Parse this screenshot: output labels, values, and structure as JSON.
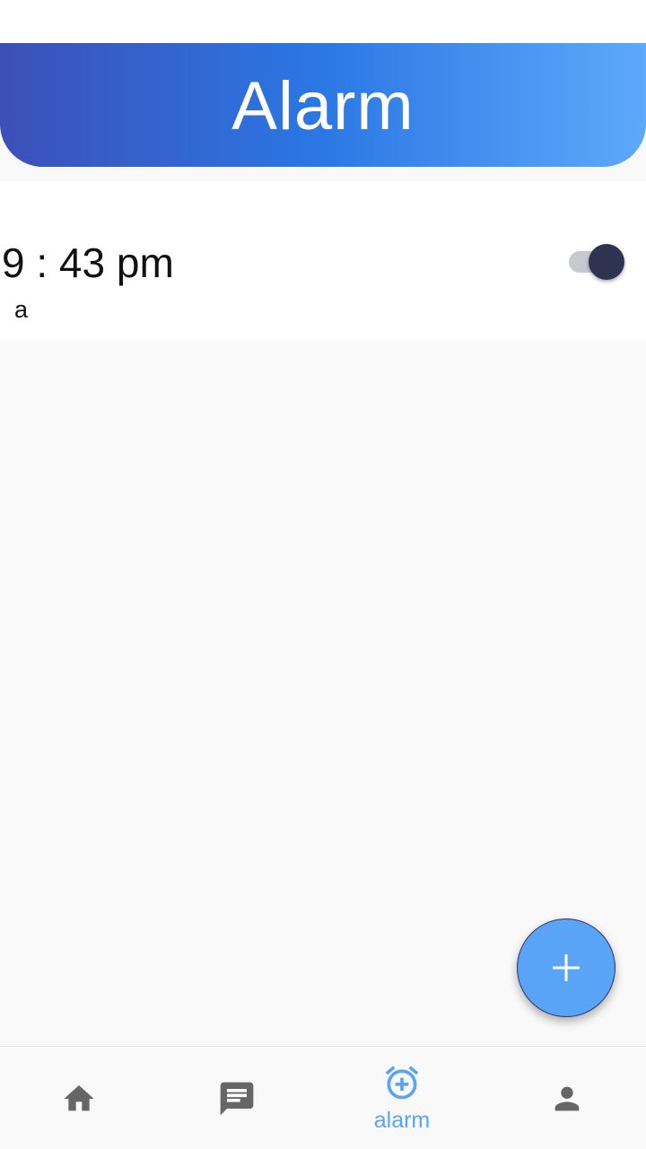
{
  "header": {
    "title": "Alarm"
  },
  "alarms": [
    {
      "time": "9 : 43 pm",
      "label": "a",
      "enabled": true
    }
  ],
  "fab": {
    "icon": "plus-icon"
  },
  "bottom_nav": {
    "items": [
      {
        "icon": "home-icon",
        "label": "",
        "active": false
      },
      {
        "icon": "chat-icon",
        "label": "",
        "active": false
      },
      {
        "icon": "alarm-add-icon",
        "label": "alarm",
        "active": true
      },
      {
        "icon": "person-icon",
        "label": "",
        "active": false
      }
    ]
  },
  "colors": {
    "header_gradient": [
      "#3d4fb8",
      "#2b78e4",
      "#5ea9fb"
    ],
    "accent": "#5aa4f8",
    "switch_thumb": "#2f3352",
    "inactive_icon": "#666666"
  }
}
